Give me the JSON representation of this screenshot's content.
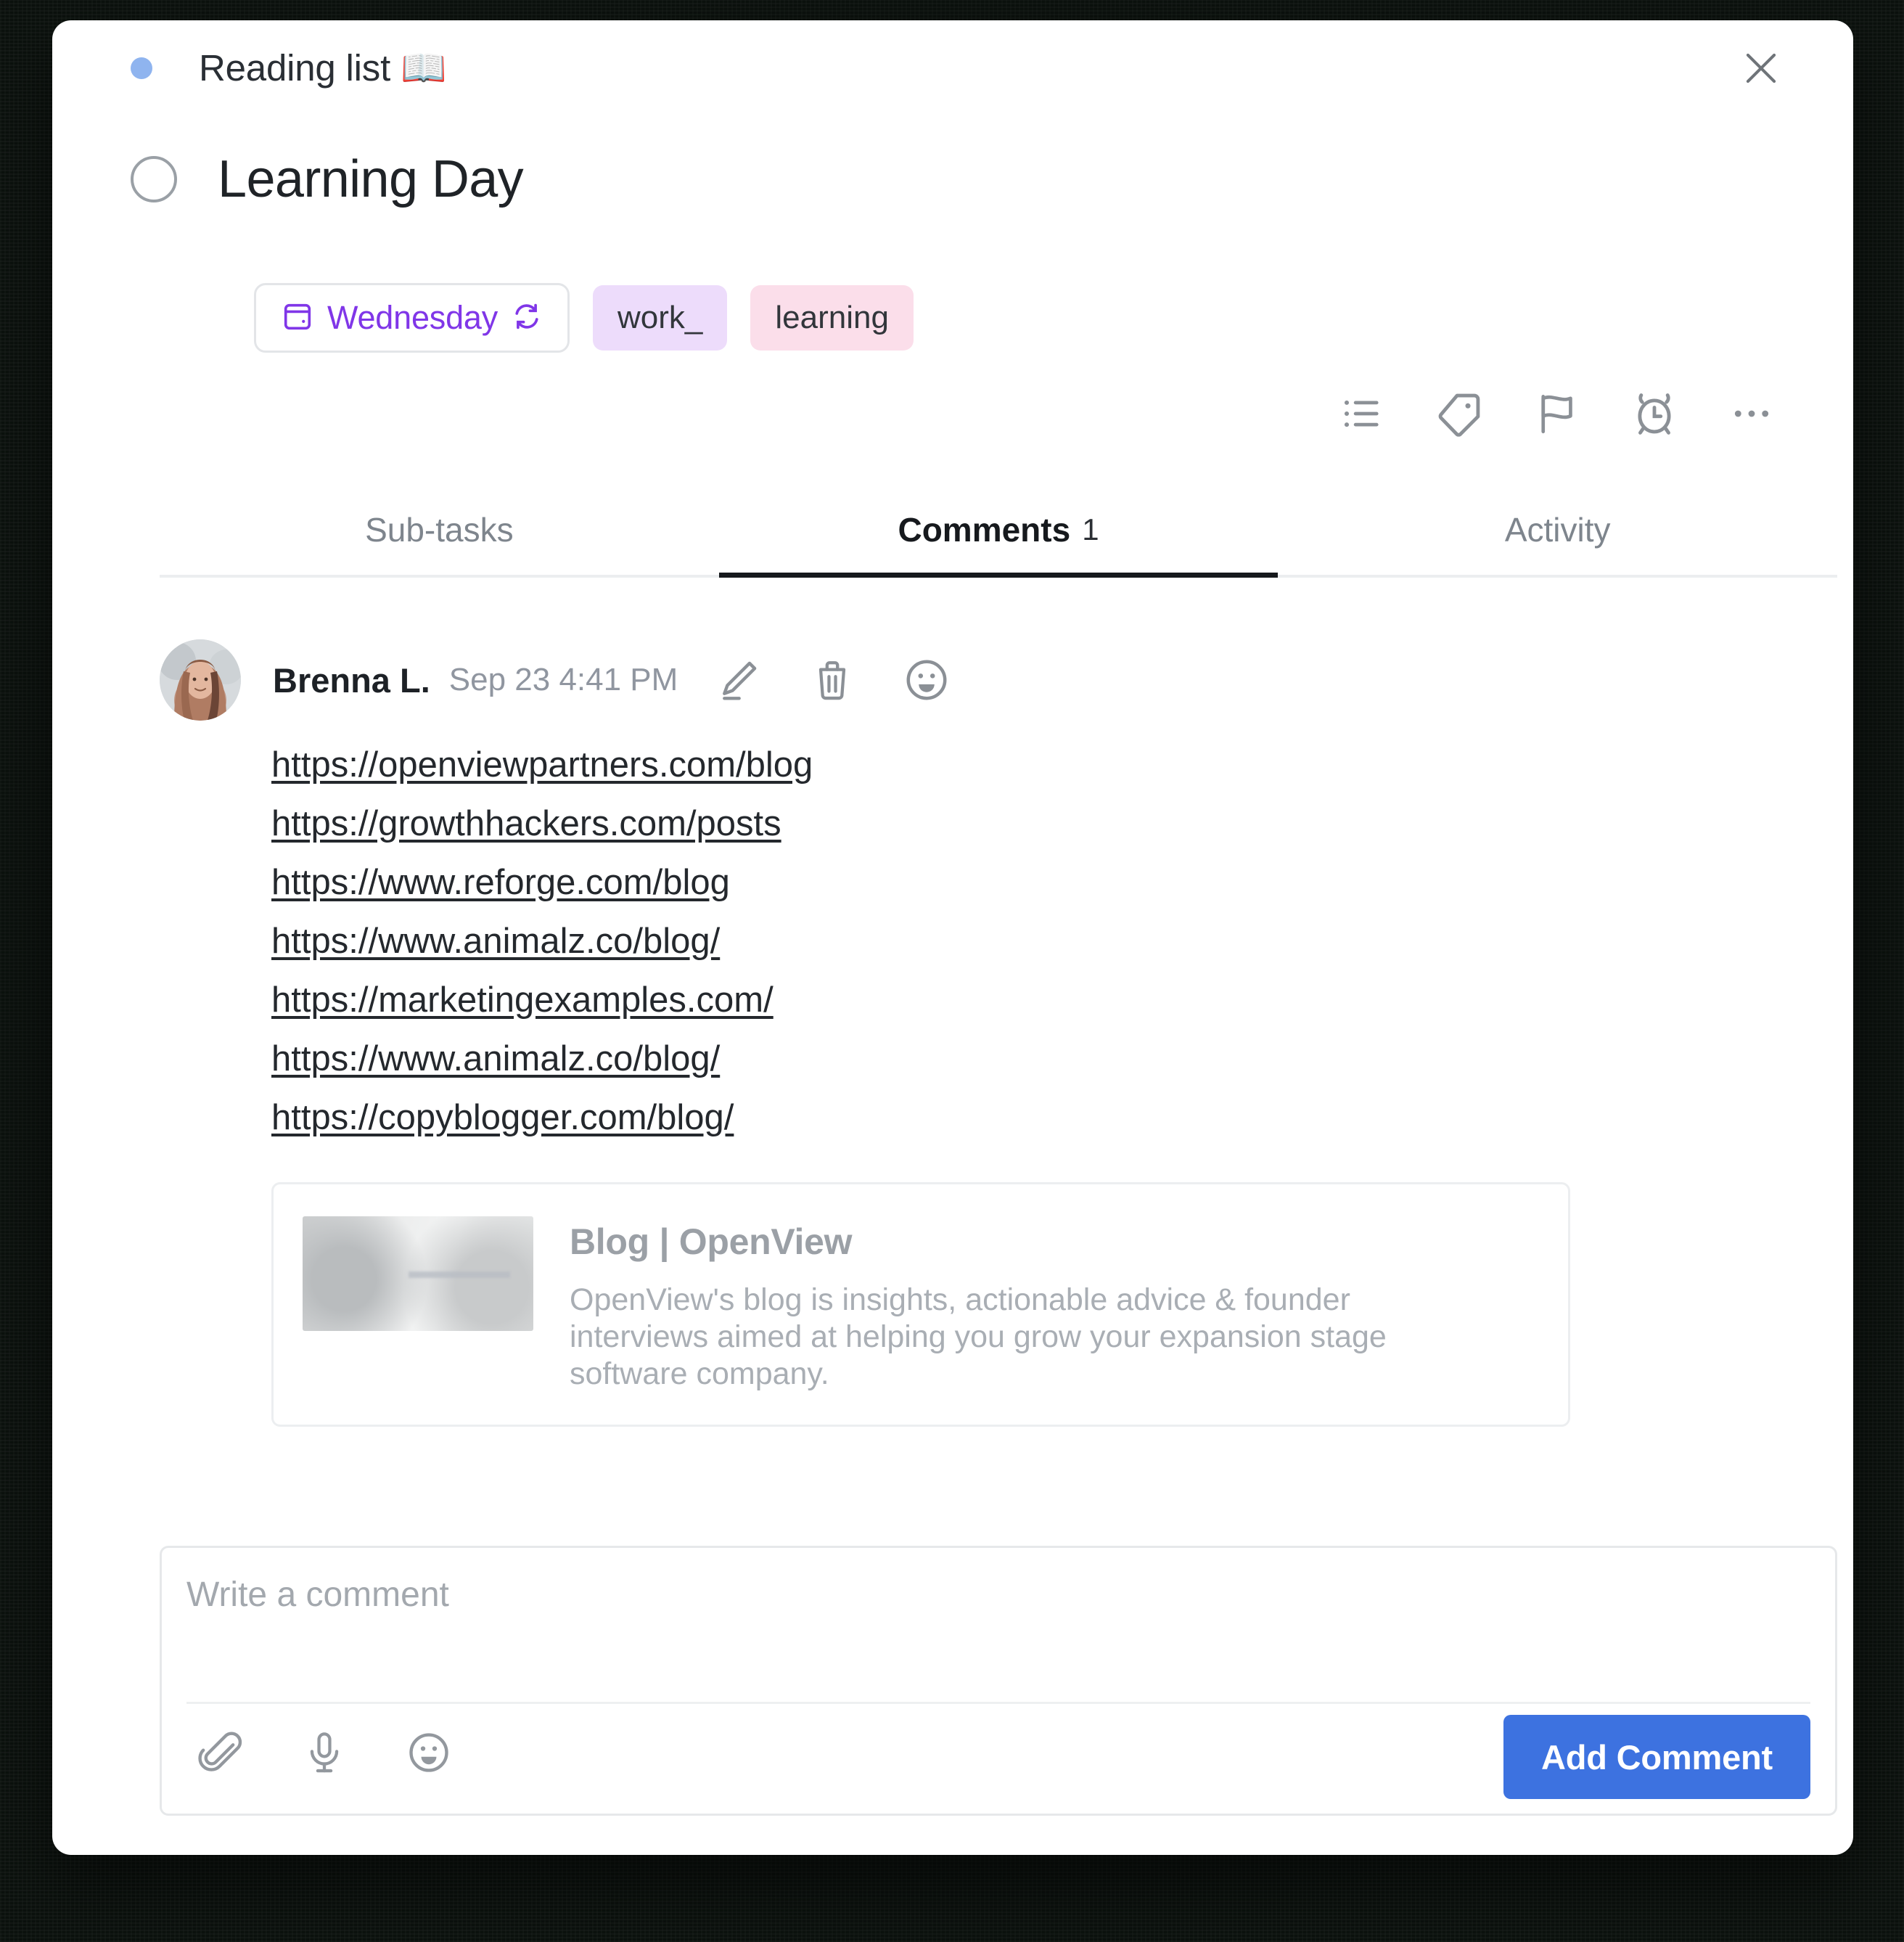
{
  "window": {
    "list_name": "Reading list 📖",
    "list_dot_color": "#8fb4ef",
    "close_icon": "close-icon"
  },
  "task": {
    "title": "Learning Day",
    "checkbox_state": "unchecked",
    "date_chip": {
      "label": "Wednesday",
      "calendar_icon": "calendar-icon",
      "recurring_icon": "recurring-icon",
      "color": "#8036e8"
    },
    "tags": [
      {
        "label": "work_",
        "bg": "#eddcfb"
      },
      {
        "label": "learning",
        "bg": "#fbdeea"
      }
    ],
    "actions": [
      {
        "name": "subtasks-icon"
      },
      {
        "name": "tag-icon"
      },
      {
        "name": "flag-icon"
      },
      {
        "name": "reminder-icon"
      },
      {
        "name": "more-icon"
      }
    ]
  },
  "tabs": [
    {
      "label": "Sub-tasks",
      "count": "",
      "active": false
    },
    {
      "label": "Comments",
      "count": "1",
      "active": true
    },
    {
      "label": "Activity",
      "count": "",
      "active": false
    }
  ],
  "comment": {
    "author": "Brenna L.",
    "timestamp": "Sep 23 4:41 PM",
    "actions": [
      {
        "name": "edit-icon"
      },
      {
        "name": "delete-icon"
      },
      {
        "name": "react-icon"
      }
    ],
    "links": [
      "https://openviewpartners.com/blog",
      "https://growthhackers.com/posts",
      "https://www.reforge.com/blog",
      "https://www.animalz.co/blog/",
      "https://marketingexamples.com/",
      "https://www.animalz.co/blog/",
      "https://copyblogger.com/blog/"
    ],
    "preview": {
      "title": "Blog | OpenView",
      "description": "OpenView's blog is insights, actionable advice & founder interviews aimed at helping you grow your expansion stage software company."
    }
  },
  "composer": {
    "placeholder": "Write a comment",
    "value": "",
    "tools": [
      {
        "name": "attachment-icon"
      },
      {
        "name": "microphone-icon"
      },
      {
        "name": "emoji-icon"
      }
    ],
    "submit_label": "Add Comment",
    "submit_color": "#3d72e0"
  }
}
